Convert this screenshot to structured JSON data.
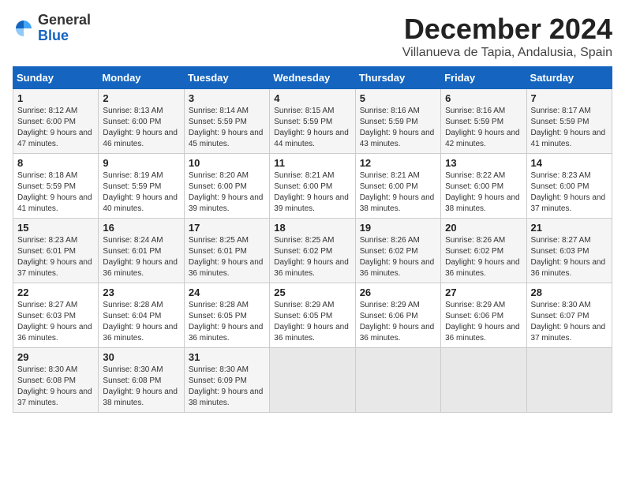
{
  "logo": {
    "general": "General",
    "blue": "Blue"
  },
  "header": {
    "month": "December 2024",
    "location": "Villanueva de Tapia, Andalusia, Spain"
  },
  "weekdays": [
    "Sunday",
    "Monday",
    "Tuesday",
    "Wednesday",
    "Thursday",
    "Friday",
    "Saturday"
  ],
  "weeks": [
    [
      {
        "day": "1",
        "sunrise": "8:12 AM",
        "sunset": "6:00 PM",
        "daylight": "9 hours and 47 minutes."
      },
      {
        "day": "2",
        "sunrise": "8:13 AM",
        "sunset": "6:00 PM",
        "daylight": "9 hours and 46 minutes."
      },
      {
        "day": "3",
        "sunrise": "8:14 AM",
        "sunset": "5:59 PM",
        "daylight": "9 hours and 45 minutes."
      },
      {
        "day": "4",
        "sunrise": "8:15 AM",
        "sunset": "5:59 PM",
        "daylight": "9 hours and 44 minutes."
      },
      {
        "day": "5",
        "sunrise": "8:16 AM",
        "sunset": "5:59 PM",
        "daylight": "9 hours and 43 minutes."
      },
      {
        "day": "6",
        "sunrise": "8:16 AM",
        "sunset": "5:59 PM",
        "daylight": "9 hours and 42 minutes."
      },
      {
        "day": "7",
        "sunrise": "8:17 AM",
        "sunset": "5:59 PM",
        "daylight": "9 hours and 41 minutes."
      }
    ],
    [
      {
        "day": "8",
        "sunrise": "8:18 AM",
        "sunset": "5:59 PM",
        "daylight": "9 hours and 41 minutes."
      },
      {
        "day": "9",
        "sunrise": "8:19 AM",
        "sunset": "5:59 PM",
        "daylight": "9 hours and 40 minutes."
      },
      {
        "day": "10",
        "sunrise": "8:20 AM",
        "sunset": "6:00 PM",
        "daylight": "9 hours and 39 minutes."
      },
      {
        "day": "11",
        "sunrise": "8:21 AM",
        "sunset": "6:00 PM",
        "daylight": "9 hours and 39 minutes."
      },
      {
        "day": "12",
        "sunrise": "8:21 AM",
        "sunset": "6:00 PM",
        "daylight": "9 hours and 38 minutes."
      },
      {
        "day": "13",
        "sunrise": "8:22 AM",
        "sunset": "6:00 PM",
        "daylight": "9 hours and 38 minutes."
      },
      {
        "day": "14",
        "sunrise": "8:23 AM",
        "sunset": "6:00 PM",
        "daylight": "9 hours and 37 minutes."
      }
    ],
    [
      {
        "day": "15",
        "sunrise": "8:23 AM",
        "sunset": "6:01 PM",
        "daylight": "9 hours and 37 minutes."
      },
      {
        "day": "16",
        "sunrise": "8:24 AM",
        "sunset": "6:01 PM",
        "daylight": "9 hours and 36 minutes."
      },
      {
        "day": "17",
        "sunrise": "8:25 AM",
        "sunset": "6:01 PM",
        "daylight": "9 hours and 36 minutes."
      },
      {
        "day": "18",
        "sunrise": "8:25 AM",
        "sunset": "6:02 PM",
        "daylight": "9 hours and 36 minutes."
      },
      {
        "day": "19",
        "sunrise": "8:26 AM",
        "sunset": "6:02 PM",
        "daylight": "9 hours and 36 minutes."
      },
      {
        "day": "20",
        "sunrise": "8:26 AM",
        "sunset": "6:02 PM",
        "daylight": "9 hours and 36 minutes."
      },
      {
        "day": "21",
        "sunrise": "8:27 AM",
        "sunset": "6:03 PM",
        "daylight": "9 hours and 36 minutes."
      }
    ],
    [
      {
        "day": "22",
        "sunrise": "8:27 AM",
        "sunset": "6:03 PM",
        "daylight": "9 hours and 36 minutes."
      },
      {
        "day": "23",
        "sunrise": "8:28 AM",
        "sunset": "6:04 PM",
        "daylight": "9 hours and 36 minutes."
      },
      {
        "day": "24",
        "sunrise": "8:28 AM",
        "sunset": "6:05 PM",
        "daylight": "9 hours and 36 minutes."
      },
      {
        "day": "25",
        "sunrise": "8:29 AM",
        "sunset": "6:05 PM",
        "daylight": "9 hours and 36 minutes."
      },
      {
        "day": "26",
        "sunrise": "8:29 AM",
        "sunset": "6:06 PM",
        "daylight": "9 hours and 36 minutes."
      },
      {
        "day": "27",
        "sunrise": "8:29 AM",
        "sunset": "6:06 PM",
        "daylight": "9 hours and 36 minutes."
      },
      {
        "day": "28",
        "sunrise": "8:30 AM",
        "sunset": "6:07 PM",
        "daylight": "9 hours and 37 minutes."
      }
    ],
    [
      {
        "day": "29",
        "sunrise": "8:30 AM",
        "sunset": "6:08 PM",
        "daylight": "9 hours and 37 minutes."
      },
      {
        "day": "30",
        "sunrise": "8:30 AM",
        "sunset": "6:08 PM",
        "daylight": "9 hours and 38 minutes."
      },
      {
        "day": "31",
        "sunrise": "8:30 AM",
        "sunset": "6:09 PM",
        "daylight": "9 hours and 38 minutes."
      },
      null,
      null,
      null,
      null
    ]
  ]
}
